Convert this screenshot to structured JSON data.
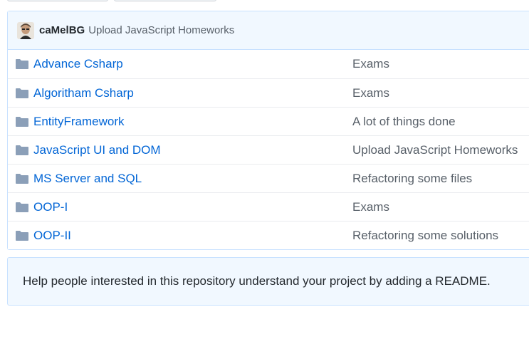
{
  "commit": {
    "author": "caMelBG",
    "message": "Upload JavaScript Homeworks"
  },
  "files": [
    {
      "name": "Advance Csharp",
      "message": "Exams",
      "icon": "folder-icon"
    },
    {
      "name": "Algoritham Csharp",
      "message": "Exams",
      "icon": "folder-icon"
    },
    {
      "name": "EntityFramework",
      "message": "A lot of things done",
      "icon": "folder-icon"
    },
    {
      "name": "JavaScript UI and DOM",
      "message": "Upload JavaScript Homeworks",
      "icon": "folder-icon"
    },
    {
      "name": "MS Server and SQL",
      "message": "Refactoring some files",
      "icon": "folder-icon"
    },
    {
      "name": "OOP-I",
      "message": "Exams",
      "icon": "folder-icon"
    },
    {
      "name": "OOP-II",
      "message": "Refactoring some solutions",
      "icon": "folder-icon"
    }
  ],
  "readme_prompt": "Help people interested in this repository understand your project by adding a README.",
  "colors": {
    "link": "#0366d6",
    "folder": "#79b8ff",
    "commit_bar": "#f1f8ff",
    "border": "#c8e1ff"
  }
}
